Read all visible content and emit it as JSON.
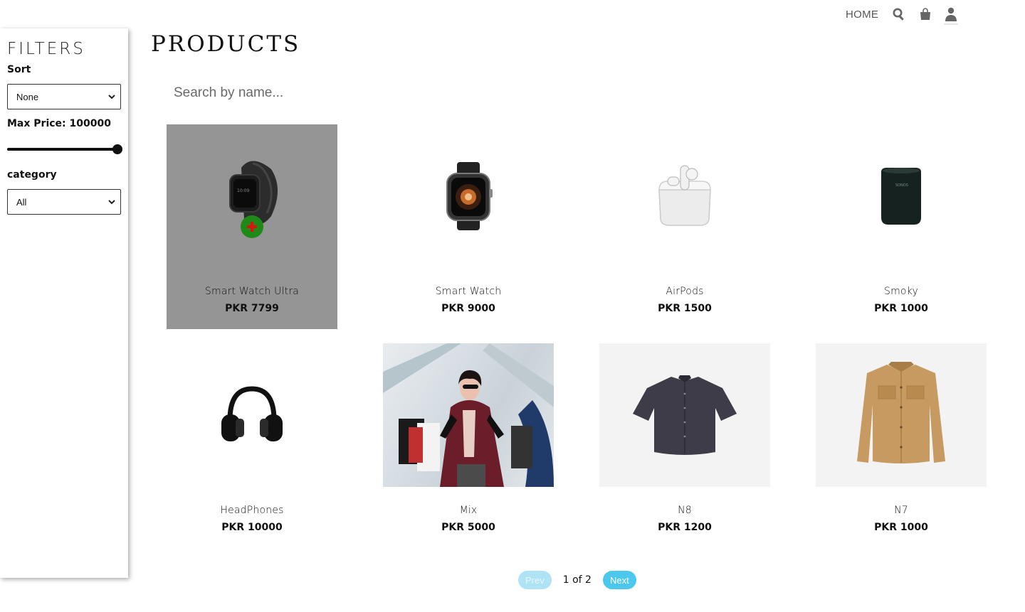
{
  "nav": {
    "home_label": "HOME",
    "icons": [
      "search-icon",
      "shopping-bag-icon",
      "user-icon"
    ]
  },
  "filters": {
    "title": "FILTERS",
    "sort": {
      "label": "Sort",
      "value": "None"
    },
    "max_price": {
      "label": "Max Price: 100000",
      "value": 100000,
      "slider_fraction": 0.97
    },
    "category": {
      "label": "category",
      "value": "All"
    }
  },
  "main": {
    "title": "PRODUCTS",
    "search": {
      "placeholder": "Search by name...",
      "value": ""
    },
    "products": [
      {
        "name": "Smart Watch Ultra",
        "price": "PKR 7799",
        "image": "smartwatch-milanese-icon",
        "hovered": true
      },
      {
        "name": "Smart Watch",
        "price": "PKR 9000",
        "image": "smartwatch-icon"
      },
      {
        "name": "AirPods",
        "price": "PKR 1500",
        "image": "airpods-icon"
      },
      {
        "name": "Smoky",
        "price": "PKR 1000",
        "image": "speaker-icon"
      },
      {
        "name": "HeadPhones",
        "price": "PKR 10000",
        "image": "headphones-icon"
      },
      {
        "name": "Mix",
        "price": "PKR 5000",
        "image": "shopping-woman-photo"
      },
      {
        "name": "N8",
        "price": "PKR 1200",
        "image": "shirt-icon"
      },
      {
        "name": "N7",
        "price": "PKR 1000",
        "image": "jacket-icon"
      }
    ]
  },
  "pagination": {
    "prev_label": "Prev",
    "page_text": "1 of 2",
    "next_label": "Next"
  },
  "colors": {
    "accent": "#4cc8ee",
    "add_button": "#1f8a18",
    "add_plus": "#e01010",
    "hover_card": "#959595"
  }
}
